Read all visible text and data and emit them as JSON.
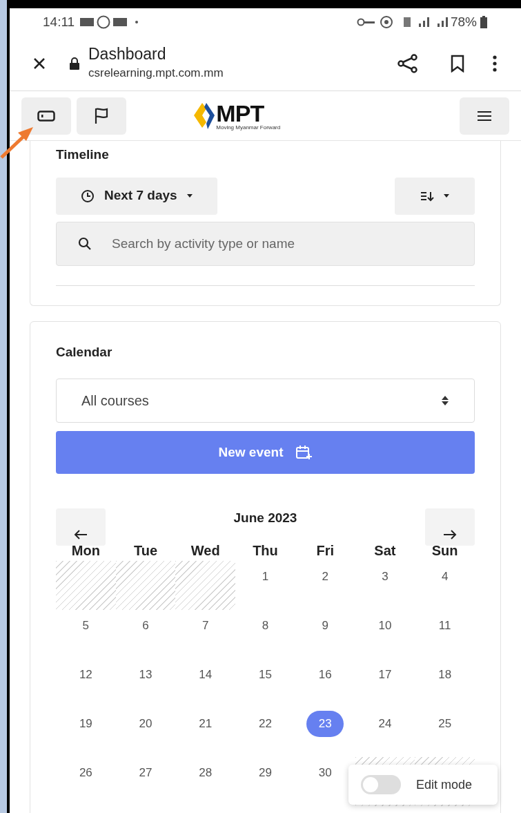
{
  "status_bar": {
    "time": "14:11",
    "battery": "78%"
  },
  "browser": {
    "title": "Dashboard",
    "url": "csrelearning.mpt.com.mm"
  },
  "site_header": {
    "logo_text": "MPT",
    "logo_tagline": "Moving Myanmar Forward"
  },
  "timeline": {
    "title": "Timeline",
    "range": "Next 7 days",
    "search": {
      "placeholder": "Search by activity type or name"
    }
  },
  "calendar": {
    "title": "Calendar",
    "course_select": "All courses",
    "new_event": "New event",
    "month": "June 2023",
    "weekdays": [
      "Mon",
      "Tue",
      "Wed",
      "Thu",
      "Fri",
      "Sat",
      "Sun"
    ],
    "days": [
      {
        "kind": "outside"
      },
      {
        "kind": "outside"
      },
      {
        "kind": "outside"
      },
      {
        "kind": "day",
        "label": "1",
        "selected": false
      },
      {
        "kind": "day",
        "label": "2",
        "selected": false
      },
      {
        "kind": "day",
        "label": "3",
        "selected": false
      },
      {
        "kind": "day",
        "label": "4",
        "selected": false
      },
      {
        "kind": "day",
        "label": "5",
        "selected": false
      },
      {
        "kind": "day",
        "label": "6",
        "selected": false
      },
      {
        "kind": "day",
        "label": "7",
        "selected": false
      },
      {
        "kind": "day",
        "label": "8",
        "selected": false
      },
      {
        "kind": "day",
        "label": "9",
        "selected": false
      },
      {
        "kind": "day",
        "label": "10",
        "selected": false
      },
      {
        "kind": "day",
        "label": "11",
        "selected": false
      },
      {
        "kind": "day",
        "label": "12",
        "selected": false
      },
      {
        "kind": "day",
        "label": "13",
        "selected": false
      },
      {
        "kind": "day",
        "label": "14",
        "selected": false
      },
      {
        "kind": "day",
        "label": "15",
        "selected": false
      },
      {
        "kind": "day",
        "label": "16",
        "selected": false
      },
      {
        "kind": "day",
        "label": "17",
        "selected": false
      },
      {
        "kind": "day",
        "label": "18",
        "selected": false
      },
      {
        "kind": "day",
        "label": "19",
        "selected": false
      },
      {
        "kind": "day",
        "label": "20",
        "selected": false
      },
      {
        "kind": "day",
        "label": "21",
        "selected": false
      },
      {
        "kind": "day",
        "label": "22",
        "selected": false
      },
      {
        "kind": "day",
        "label": "23",
        "selected": true
      },
      {
        "kind": "day",
        "label": "24",
        "selected": false
      },
      {
        "kind": "day",
        "label": "25",
        "selected": false
      },
      {
        "kind": "day",
        "label": "26",
        "selected": false
      },
      {
        "kind": "day",
        "label": "27",
        "selected": false
      },
      {
        "kind": "day",
        "label": "28",
        "selected": false
      },
      {
        "kind": "day",
        "label": "29",
        "selected": false
      },
      {
        "kind": "day",
        "label": "30",
        "selected": false
      },
      {
        "kind": "outside"
      },
      {
        "kind": "outside"
      }
    ]
  },
  "edit_mode": {
    "label": "Edit mode",
    "on": false
  }
}
